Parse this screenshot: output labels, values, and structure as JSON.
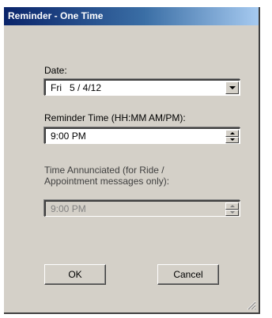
{
  "window": {
    "title": "Reminder - One Time"
  },
  "date": {
    "label": "Date:",
    "value": "Fri   5 / 4/12"
  },
  "reminder_time": {
    "label": "Reminder Time (HH:MM   AM/PM):",
    "value": "9:00 PM"
  },
  "annunciated": {
    "label_line1": "Time Annunciated (for Ride /",
    "label_line2": "Appointment messages only):",
    "value": "9:00 PM"
  },
  "buttons": {
    "ok": "OK",
    "cancel": "Cancel"
  }
}
